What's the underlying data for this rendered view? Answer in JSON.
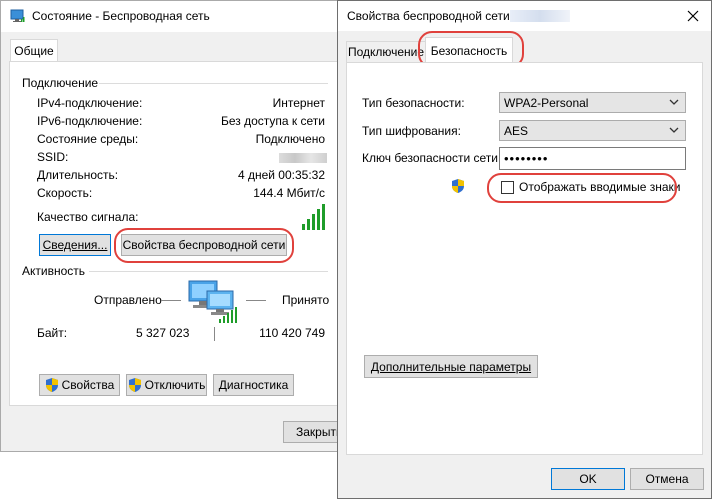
{
  "status_window": {
    "title": "Состояние - Беспроводная сеть",
    "tab_general": "Общие",
    "connection_group": "Подключение",
    "rows": [
      {
        "label": "IPv4-подключение:",
        "value": "Интернет"
      },
      {
        "label": "IPv6-подключение:",
        "value": "Без доступа к сети"
      },
      {
        "label": "Состояние среды:",
        "value": "Подключено"
      },
      {
        "label": "SSID:",
        "value": ""
      },
      {
        "label": "Длительность:",
        "value": "4 дней 00:35:32"
      },
      {
        "label": "Скорость:",
        "value": "144.4 Мбит/с"
      }
    ],
    "signal_quality_label": "Качество сигнала:",
    "details_button": "Сведения...",
    "wireless_props_button": "Свойства беспроводной сети",
    "activity_group": "Активность",
    "sent_label": "Отправлено",
    "received_label": "Принято",
    "bytes_label": "Байт:",
    "bytes_sent": "5 327 023",
    "bytes_received": "110 420 749",
    "properties_button": "Свойства",
    "disable_button": "Отключить",
    "diagnose_button": "Диагностика",
    "close_button": "Закрыть"
  },
  "props_window": {
    "title": "Свойства беспроводной сети",
    "tab_connection": "Подключение",
    "tab_security": "Безопасность",
    "security_type_label": "Тип безопасности:",
    "security_type_value": "WPA2-Personal",
    "encryption_type_label": "Тип шифрования:",
    "encryption_type_value": "AES",
    "key_label": "Ключ безопасности сети",
    "key_value": "••••••••",
    "show_chars_label": "Отображать вводимые знаки",
    "advanced_button": "Дополнительные параметры",
    "ok_button": "OK",
    "cancel_button": "Отмена"
  },
  "colors": {
    "highlight_oval": "#e0413c",
    "signal_green": "#1f9d2a",
    "focus_blue": "#0078d7"
  }
}
